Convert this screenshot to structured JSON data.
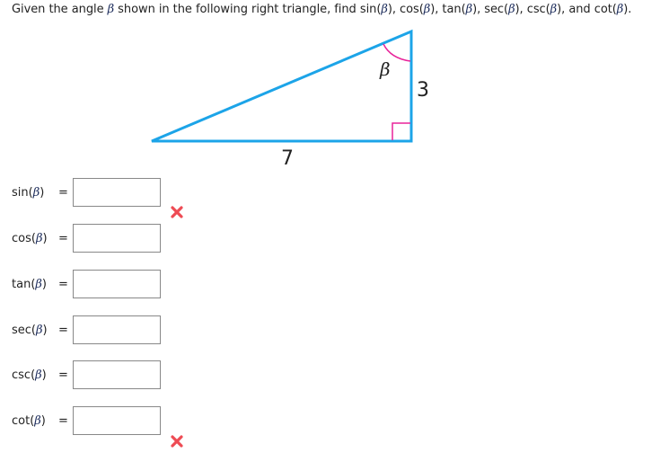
{
  "prompt": {
    "prefix": "Given the angle ",
    "beta": "β",
    "middle": " shown in the following right triangle, find ",
    "functions_text": [
      {
        "name": "sin(",
        "arg": "β",
        "close": "), "
      },
      {
        "name": "cos(",
        "arg": "β",
        "close": "), "
      },
      {
        "name": "tan(",
        "arg": "β",
        "close": "), "
      },
      {
        "name": "sec(",
        "arg": "β",
        "close": "), "
      },
      {
        "name": "csc(",
        "arg": "β",
        "close": "), and "
      },
      {
        "name": "cot(",
        "arg": "β",
        "close": ")."
      }
    ]
  },
  "triangle": {
    "angle_label": "β",
    "side_vertical": "3",
    "side_horizontal": "7",
    "colors": {
      "sides": "#1ca4e8",
      "angle_marks": "#e8239a",
      "text": "#222222"
    }
  },
  "answers": [
    {
      "func": "sin",
      "arg": "β",
      "value": "",
      "placeholder": "",
      "status": "incorrect"
    },
    {
      "func": "cos",
      "arg": "β",
      "value": "",
      "placeholder": "",
      "status": "none"
    },
    {
      "func": "tan",
      "arg": "β",
      "value": "",
      "placeholder": "",
      "status": "none"
    },
    {
      "func": "sec",
      "arg": "β",
      "value": "",
      "placeholder": "",
      "status": "none"
    },
    {
      "func": "csc",
      "arg": "β",
      "value": "",
      "placeholder": "",
      "status": "none"
    },
    {
      "func": "cot",
      "arg": "β",
      "value": "",
      "placeholder": "",
      "status": "incorrect"
    }
  ],
  "equals_sign": "=",
  "icons": {
    "incorrect": "x-mark-icon",
    "incorrect_color": "#ee4b54"
  }
}
